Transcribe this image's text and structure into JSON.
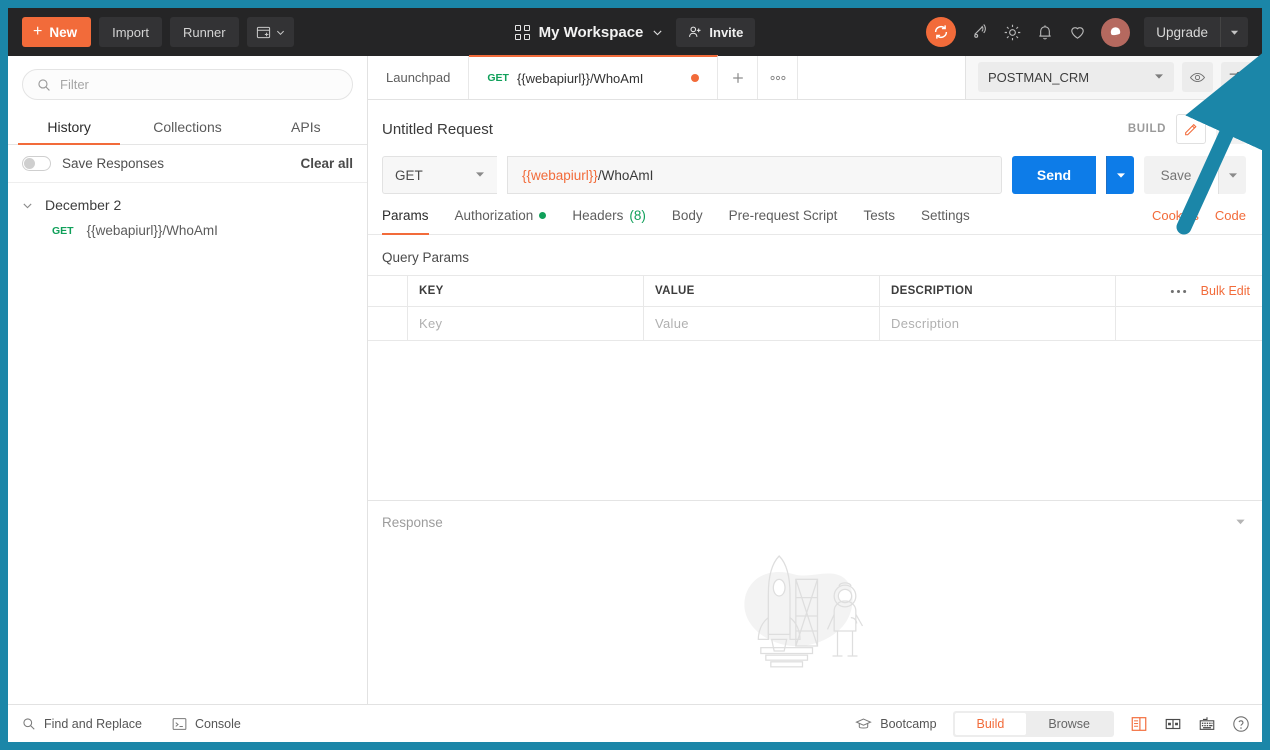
{
  "header": {
    "new_button": "New",
    "new_icon": "plus-icon",
    "import_button": "Import",
    "runner_button": "Runner",
    "new_window_icon": "new-window-icon",
    "workspace_name": "My Workspace",
    "workspace_icon": "grid-icon",
    "invite_button": "Invite",
    "invite_icon": "person-add-icon",
    "sync_icon": "sync-icon",
    "broadcast_icon": "broadcast-icon",
    "settings_icon": "gear-icon",
    "notifications_icon": "bell-icon",
    "favorites_icon": "heart-icon",
    "avatar_icon": "planet-avatar-icon",
    "upgrade_button": "Upgrade",
    "upgrade_caret_icon": "chevron-down-icon"
  },
  "sidebar": {
    "filter_placeholder": "Filter",
    "search_icon": "search-icon",
    "tabs": [
      {
        "label": "History",
        "active": true
      },
      {
        "label": "Collections",
        "active": false
      },
      {
        "label": "APIs",
        "active": false
      }
    ],
    "save_responses_label": "Save Responses",
    "save_responses_on": false,
    "clear_all_label": "Clear all",
    "history_groups": [
      {
        "date": "December 2",
        "expanded": true,
        "items": [
          {
            "method": "GET",
            "url": "{{webapiurl}}/WhoAmI"
          }
        ]
      }
    ]
  },
  "tabstrip": {
    "tabs": [
      {
        "label": "Launchpad",
        "method": "",
        "active": false,
        "unsaved": false
      },
      {
        "label": "{{webapiurl}}/WhoAmI",
        "method": "GET",
        "active": true,
        "unsaved": true
      }
    ],
    "add_tab_icon": "plus-icon",
    "more_tabs_icon": "ellipsis-icon"
  },
  "environment": {
    "selected": "POSTMAN_CRM",
    "caret_icon": "chevron-down-icon",
    "eye_icon": "eye-icon",
    "settings_icon": "sliders-icon"
  },
  "request": {
    "title": "Untitled Request",
    "build_label": "BUILD",
    "edit_icon": "pencil-icon",
    "comment_icon": "comment-icon",
    "method": "GET",
    "method_caret_icon": "chevron-down-icon",
    "url_variable": "{{webapiurl}}",
    "url_path": "/WhoAmI",
    "send_label": "Send",
    "send_caret_icon": "chevron-down-icon",
    "save_label": "Save",
    "save_caret_icon": "chevron-down-icon",
    "tabs": [
      {
        "label": "Params",
        "active": true,
        "badge": "",
        "dot": false
      },
      {
        "label": "Authorization",
        "active": false,
        "badge": "",
        "dot": true
      },
      {
        "label": "Headers",
        "active": false,
        "badge": "(8)",
        "dot": false
      },
      {
        "label": "Body",
        "active": false,
        "badge": "",
        "dot": false
      },
      {
        "label": "Pre-request Script",
        "active": false,
        "badge": "",
        "dot": false
      },
      {
        "label": "Tests",
        "active": false,
        "badge": "",
        "dot": false
      },
      {
        "label": "Settings",
        "active": false,
        "badge": "",
        "dot": false
      }
    ],
    "cookies_link": "Cookies",
    "code_link": "Code"
  },
  "query_params": {
    "section_label": "Query Params",
    "columns": [
      "KEY",
      "VALUE",
      "DESCRIPTION"
    ],
    "placeholder_row": [
      "Key",
      "Value",
      "Description"
    ],
    "more_icon": "ellipsis-icon",
    "bulk_edit_label": "Bulk Edit"
  },
  "response": {
    "label": "Response",
    "caret_icon": "chevron-down-icon",
    "placeholder_illustration": "rocket-astronaut-illustration"
  },
  "footer": {
    "find_replace_label": "Find and Replace",
    "find_replace_icon": "search-icon",
    "console_label": "Console",
    "console_icon": "terminal-icon",
    "bootcamp_label": "Bootcamp",
    "bootcamp_icon": "graduation-cap-icon",
    "view_modes": [
      {
        "label": "Build",
        "active": true
      },
      {
        "label": "Browse",
        "active": false
      }
    ],
    "two_pane_icon": "two-pane-layout-icon",
    "split_pane_icon": "split-pane-layout-icon",
    "keyboard_icon": "keyboard-icon",
    "help_icon": "help-icon"
  },
  "annotation": {
    "arrow_icon": "teal-arrow-annotation",
    "color": "#1b86a8",
    "points_to": "environment-settings-icon"
  },
  "colors": {
    "frame": "#1b86a8",
    "accent_orange": "#f26b3a",
    "send_blue": "#0d7ce8",
    "header_dark": "#252526",
    "method_green": "#10a05a"
  }
}
